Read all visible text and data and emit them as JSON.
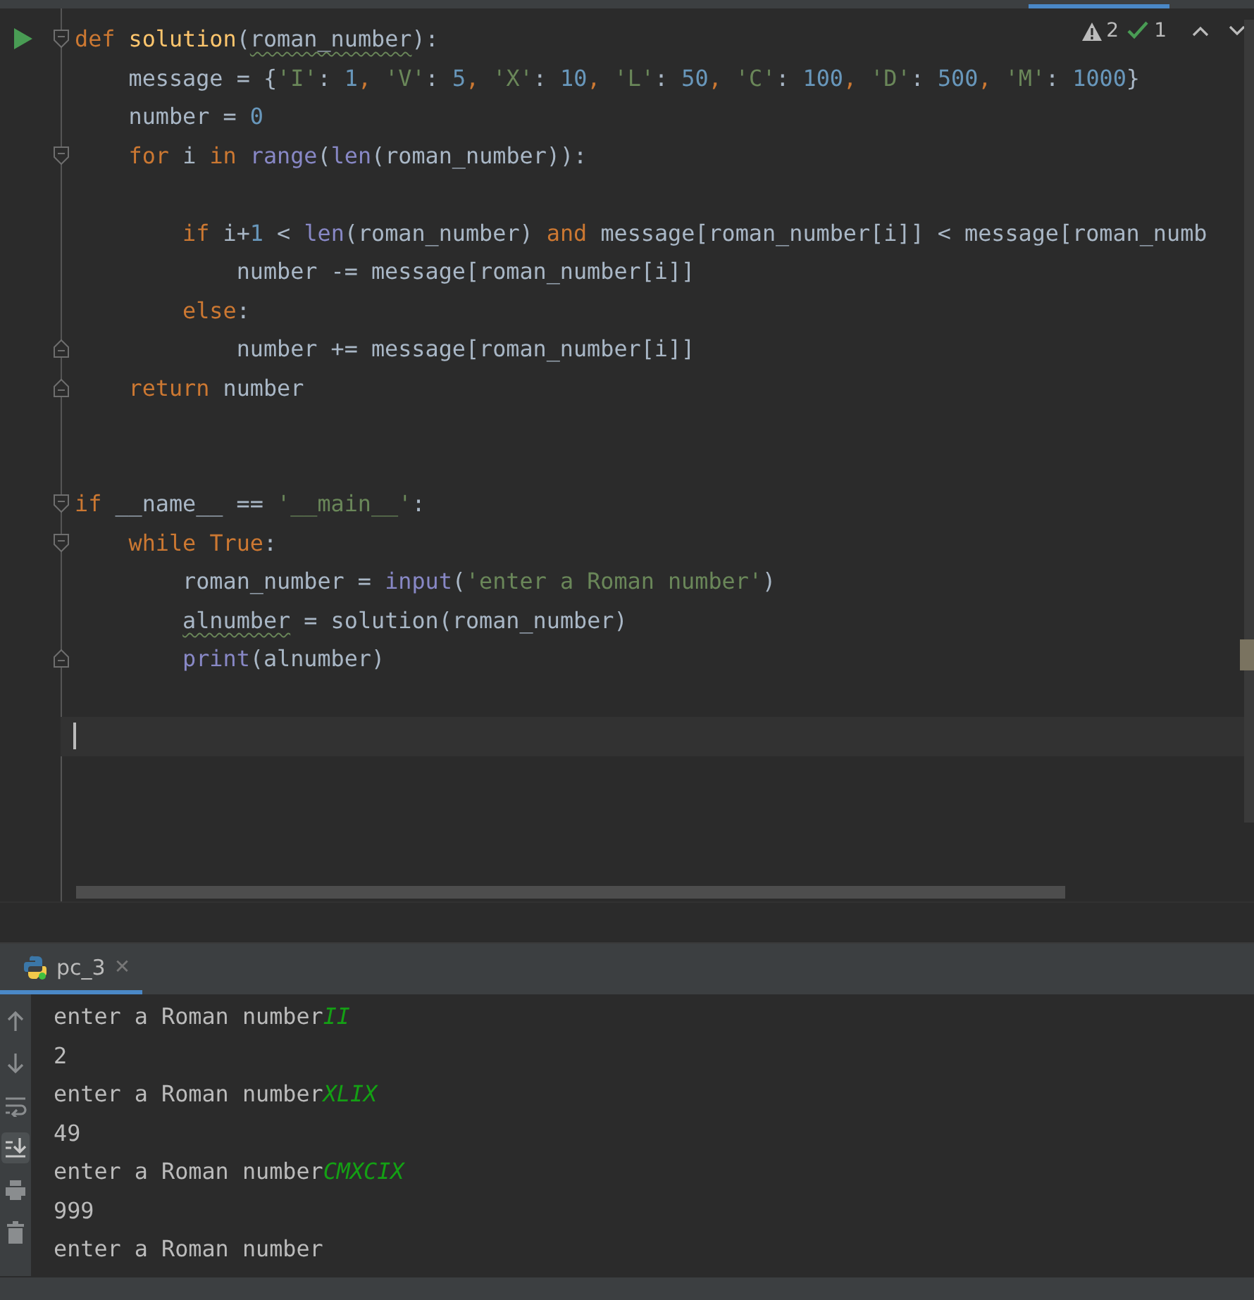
{
  "inspections": {
    "warnings": "2",
    "passed": "1"
  },
  "code_lines": [
    {
      "run": true,
      "fold_start": true,
      "tokens": [
        {
          "t": "def ",
          "kind": "kw"
        },
        {
          "t": "solution",
          "kind": "fn"
        },
        {
          "t": "(",
          "kind": "plain"
        },
        {
          "t": "roman_number",
          "kind": "typo"
        },
        {
          "t": "):",
          "kind": "plain"
        }
      ]
    },
    {
      "tokens": [
        {
          "t": "    message = {",
          "kind": "plain"
        },
        {
          "t": "'I'",
          "kind": "str"
        },
        {
          "t": ": ",
          "kind": "plain"
        },
        {
          "t": "1",
          "kind": "num"
        },
        {
          "t": ", ",
          "kind": "kw"
        },
        {
          "t": "'V'",
          "kind": "str"
        },
        {
          "t": ": ",
          "kind": "plain"
        },
        {
          "t": "5",
          "kind": "num"
        },
        {
          "t": ", ",
          "kind": "kw"
        },
        {
          "t": "'X'",
          "kind": "str"
        },
        {
          "t": ": ",
          "kind": "plain"
        },
        {
          "t": "10",
          "kind": "num"
        },
        {
          "t": ", ",
          "kind": "kw"
        },
        {
          "t": "'L'",
          "kind": "str"
        },
        {
          "t": ": ",
          "kind": "plain"
        },
        {
          "t": "50",
          "kind": "num"
        },
        {
          "t": ", ",
          "kind": "kw"
        },
        {
          "t": "'C'",
          "kind": "str"
        },
        {
          "t": ": ",
          "kind": "plain"
        },
        {
          "t": "100",
          "kind": "num"
        },
        {
          "t": ", ",
          "kind": "kw"
        },
        {
          "t": "'D'",
          "kind": "str"
        },
        {
          "t": ": ",
          "kind": "plain"
        },
        {
          "t": "500",
          "kind": "num"
        },
        {
          "t": ", ",
          "kind": "kw"
        },
        {
          "t": "'M'",
          "kind": "str"
        },
        {
          "t": ": ",
          "kind": "plain"
        },
        {
          "t": "1000",
          "kind": "num"
        },
        {
          "t": "}",
          "kind": "plain"
        }
      ]
    },
    {
      "tokens": [
        {
          "t": "    number = ",
          "kind": "plain"
        },
        {
          "t": "0",
          "kind": "num"
        }
      ]
    },
    {
      "fold_start": true,
      "tokens": [
        {
          "t": "    for ",
          "kind": "kw"
        },
        {
          "t": "i ",
          "kind": "plain"
        },
        {
          "t": "in ",
          "kind": "kw"
        },
        {
          "t": "range",
          "kind": "builtin"
        },
        {
          "t": "(",
          "kind": "plain"
        },
        {
          "t": "len",
          "kind": "builtin"
        },
        {
          "t": "(roman_number)):",
          "kind": "plain"
        }
      ]
    },
    {
      "kind": "blank"
    },
    {
      "tokens": [
        {
          "t": "        if ",
          "kind": "kw"
        },
        {
          "t": "i+",
          "kind": "plain"
        },
        {
          "t": "1",
          "kind": "num"
        },
        {
          "t": " < ",
          "kind": "plain"
        },
        {
          "t": "len",
          "kind": "builtin"
        },
        {
          "t": "(roman_number) ",
          "kind": "plain"
        },
        {
          "t": "and ",
          "kind": "kw"
        },
        {
          "t": "message[roman_number[i]] < message[roman_numb",
          "kind": "plain"
        }
      ]
    },
    {
      "tokens": [
        {
          "t": "            number -= message[roman_number[i]]",
          "kind": "plain"
        }
      ]
    },
    {
      "tokens": [
        {
          "t": "        else",
          "kind": "kw"
        },
        {
          "t": ":",
          "kind": "plain"
        }
      ]
    },
    {
      "fold_end": true,
      "tokens": [
        {
          "t": "            number += message[roman_number[i]]",
          "kind": "plain"
        }
      ]
    },
    {
      "fold_end": true,
      "tokens": [
        {
          "t": "    return ",
          "kind": "kw"
        },
        {
          "t": "number",
          "kind": "plain"
        }
      ]
    },
    {
      "kind": "blank"
    },
    {
      "kind": "blank"
    },
    {
      "fold_start": true,
      "tokens": [
        {
          "t": "if ",
          "kind": "kw"
        },
        {
          "t": "__name__ == ",
          "kind": "plain"
        },
        {
          "t": "'__main__'",
          "kind": "str"
        },
        {
          "t": ":",
          "kind": "plain"
        }
      ]
    },
    {
      "fold_start": true,
      "tokens": [
        {
          "t": "    while ",
          "kind": "kw"
        },
        {
          "t": "True",
          "kind": "kw"
        },
        {
          "t": ":",
          "kind": "plain"
        }
      ]
    },
    {
      "tokens": [
        {
          "t": "        roman_number = ",
          "kind": "plain"
        },
        {
          "t": "input",
          "kind": "builtin"
        },
        {
          "t": "(",
          "kind": "plain"
        },
        {
          "t": "'enter a Roman number'",
          "kind": "str"
        },
        {
          "t": ")",
          "kind": "plain"
        }
      ]
    },
    {
      "tokens": [
        {
          "t": "        alnumber",
          "kind": "typo"
        },
        {
          "t": " = solution(roman_number)",
          "kind": "plain"
        }
      ]
    },
    {
      "fold_end": true,
      "tokens": [
        {
          "t": "        print",
          "kind": "builtin"
        },
        {
          "t": "(alnumber)",
          "kind": "plain"
        }
      ]
    },
    {
      "kind": "blank"
    },
    {
      "kind": "blank",
      "current": true
    }
  ],
  "run_tab": {
    "label": "pc_3",
    "close": "✕",
    "selected": true
  },
  "console": [
    {
      "text": "enter a Roman number",
      "input": "II"
    },
    {
      "text": "2"
    },
    {
      "text": "enter a Roman number",
      "input": "XLIX"
    },
    {
      "text": "49"
    },
    {
      "text": "enter a Roman number",
      "input": "CMXCIX"
    },
    {
      "text": "999"
    },
    {
      "text": "enter a Roman number"
    }
  ],
  "console_tools": [
    {
      "kind": "up",
      "selected": false
    },
    {
      "kind": "down",
      "selected": false
    },
    {
      "kind": "wrap",
      "selected": false
    },
    {
      "kind": "scroll-end",
      "selected": true
    },
    {
      "kind": "print",
      "selected": false
    },
    {
      "kind": "trash",
      "selected": false
    }
  ]
}
